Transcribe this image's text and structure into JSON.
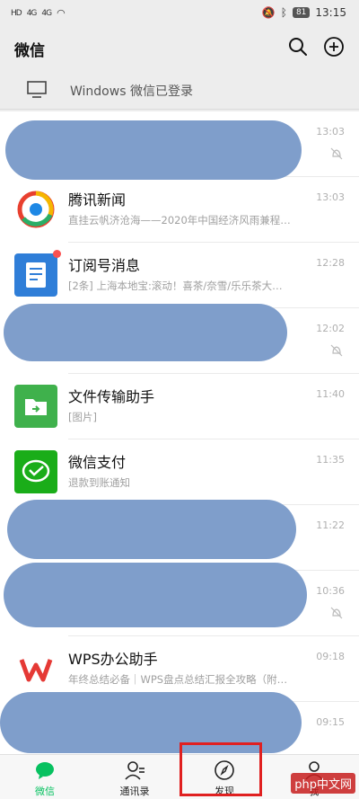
{
  "status_bar": {
    "left_tags": [
      "HD",
      "4G",
      "4G"
    ],
    "battery": "81",
    "time": "13:15"
  },
  "header": {
    "title": "微信"
  },
  "login_bar": {
    "text": "Windows 微信已登录"
  },
  "chats": [
    {
      "name": "",
      "preview": "",
      "time": "13:03",
      "muted": true,
      "redacted": true
    },
    {
      "name": "腾讯新闻",
      "preview": "直挂云帆济沧海——2020年中国经济风雨兼程…",
      "time": "13:03"
    },
    {
      "name": "订阅号消息",
      "preview": "[2条] 上海本地宝:滚动！喜茶/奈雪/乐乐茶大…",
      "time": "12:28",
      "badge": true
    },
    {
      "name": "",
      "preview": "",
      "time": "12:02",
      "muted": true,
      "redacted": true
    },
    {
      "name": "文件传输助手",
      "preview": "[图片]",
      "time": "11:40"
    },
    {
      "name": "微信支付",
      "preview": "退款到账通知",
      "time": "11:35"
    },
    {
      "name": "",
      "preview": "",
      "time": "11:22",
      "redacted": true
    },
    {
      "name": "",
      "preview": "",
      "time": "10:36",
      "muted": true,
      "redacted": true
    },
    {
      "name": "WPS办公助手",
      "preview": "年终总结必备｜WPS盘点总结汇报全攻略（附…",
      "time": "09:18"
    },
    {
      "name": "",
      "preview": "",
      "time": "09:15",
      "redacted": true
    }
  ],
  "tabs": [
    {
      "label": "微信",
      "icon": "chat-bubble-icon",
      "active": true
    },
    {
      "label": "通讯录",
      "icon": "contacts-icon"
    },
    {
      "label": "发现",
      "icon": "compass-icon"
    },
    {
      "label": "我",
      "icon": "person-icon"
    }
  ],
  "watermark": "php中文网",
  "colors": {
    "accent": "#07c160",
    "redaction": "#7f9ecb",
    "highlight": "#e02020"
  }
}
